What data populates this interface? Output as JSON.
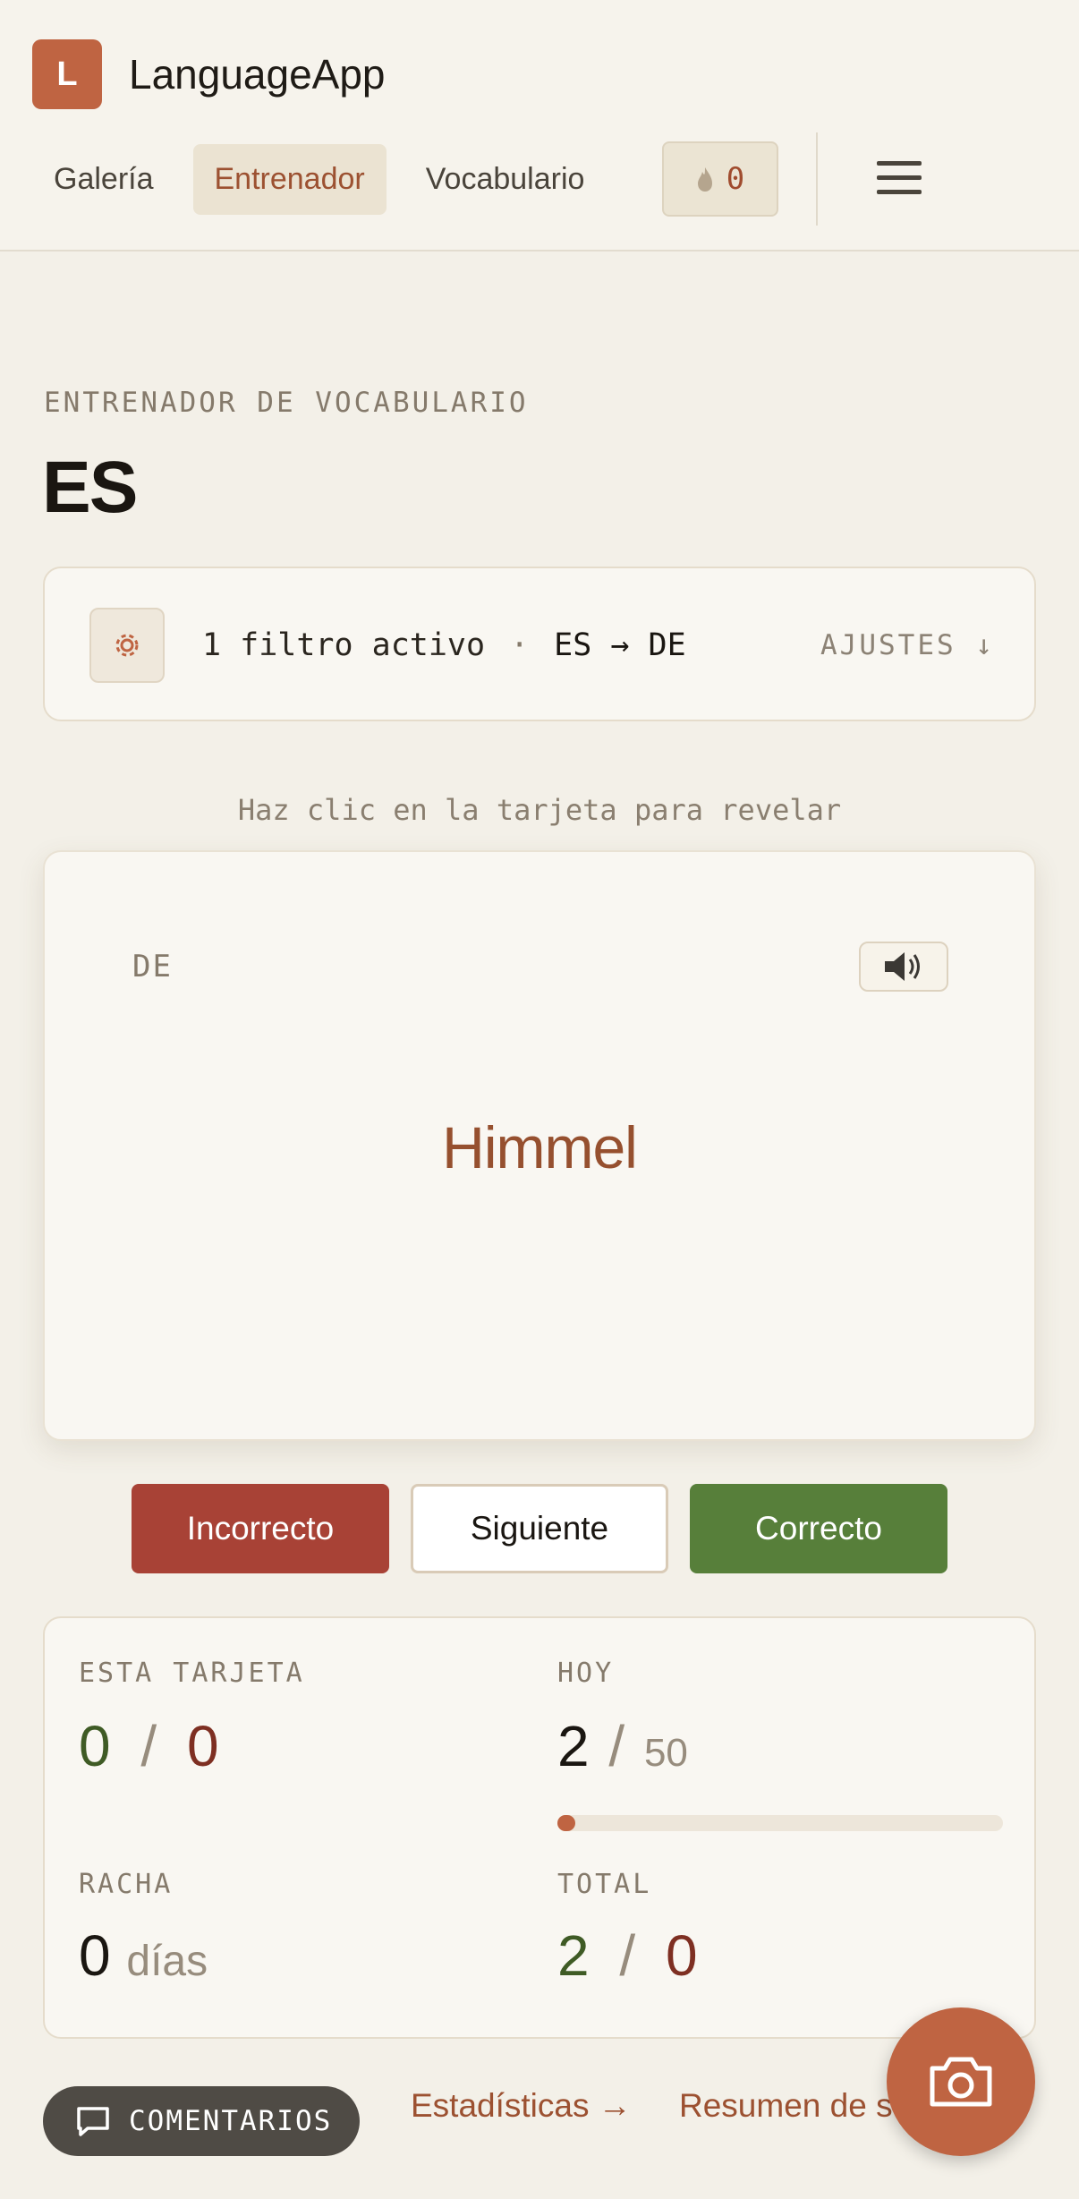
{
  "app": {
    "logo_letter": "L",
    "name": "LanguageApp"
  },
  "nav": {
    "items": [
      {
        "label": "Galería",
        "active": false
      },
      {
        "label": "Entrenador",
        "active": true
      },
      {
        "label": "Vocabulario",
        "active": false
      }
    ],
    "streak_count": "0",
    "flame_icon": "flame-icon",
    "menu_icon": "hamburger-menu-icon"
  },
  "page": {
    "eyebrow": "ENTRENADOR DE VOCABULARIO",
    "title": "ES"
  },
  "filter": {
    "icon": "gear-icon",
    "summary": "1 filtro activo",
    "separator": "·",
    "direction": "ES → DE",
    "settings_label": "AJUSTES ↓"
  },
  "hint": "Haz clic en la tarjeta para revelar",
  "card": {
    "language": "DE",
    "speaker_icon": "speaker-icon",
    "word": "Himmel"
  },
  "actions": {
    "wrong": "Incorrecto",
    "next": "Siguiente",
    "right": "Correcto"
  },
  "stats": {
    "this_card": {
      "label": "ESTA TARJETA",
      "correct": "0",
      "sep": "/",
      "wrong": "0"
    },
    "today": {
      "label": "HOY",
      "done": "2",
      "sep": "/",
      "goal": "50",
      "progress_fraction": 0.04
    },
    "streak": {
      "label": "RACHA",
      "value": "0",
      "unit": "días"
    },
    "total": {
      "label": "TOTAL",
      "correct": "2",
      "sep": "/",
      "wrong": "0"
    }
  },
  "footer": {
    "feedback_label": "COMENTARIOS",
    "feedback_icon": "chat-bubble-icon",
    "stats_link": "Estadísticas →",
    "summary_link": "Resumen de s",
    "camera_icon": "camera-icon"
  },
  "colors": {
    "accent": "#bf6442",
    "correct": "#577f3a",
    "incorrect": "#a84236",
    "background": "#f3f0e8"
  }
}
